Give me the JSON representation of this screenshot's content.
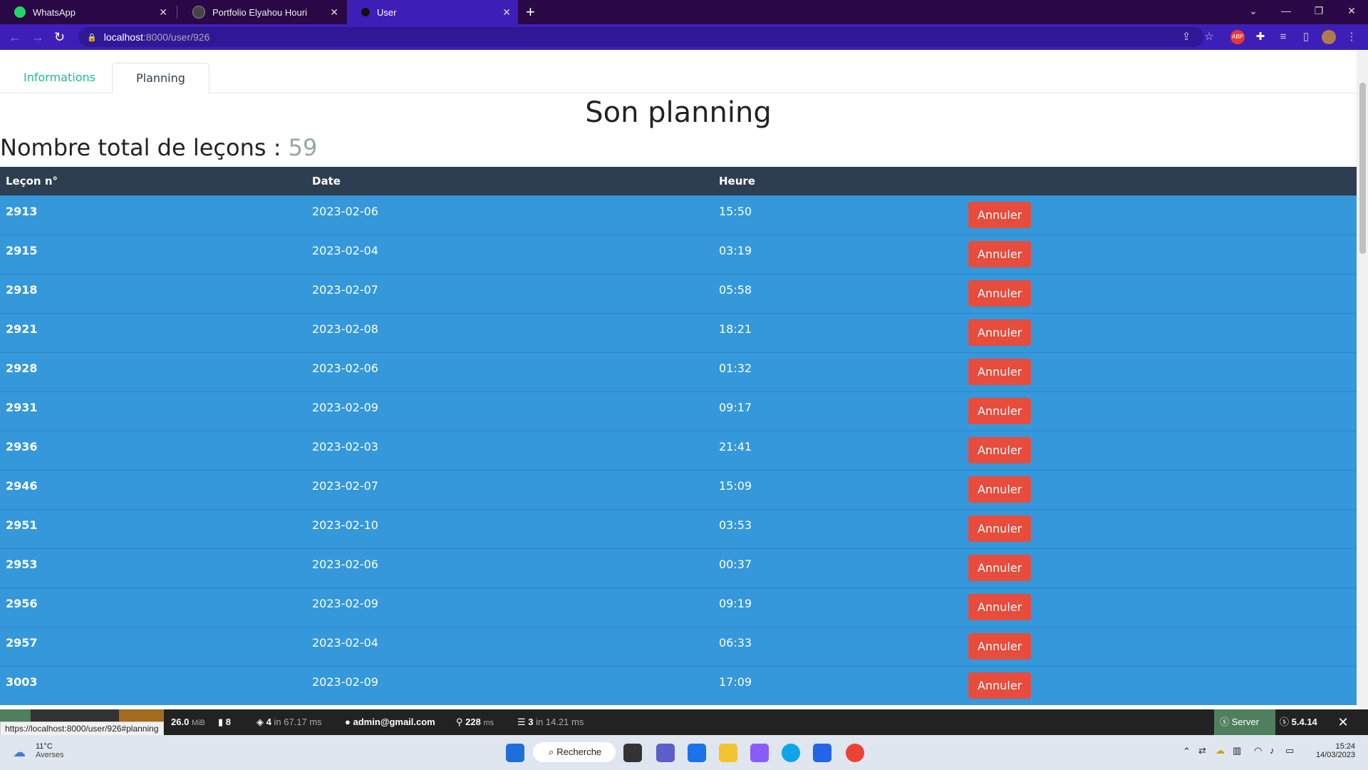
{
  "browser": {
    "tabs": [
      {
        "title": "WhatsApp",
        "icon": "whatsapp-icon"
      },
      {
        "title": "Portfolio Elyahou Houri",
        "icon": "globe-icon"
      },
      {
        "title": "User",
        "icon": "dot-icon",
        "active": true
      }
    ],
    "url_host": "localhost",
    "url_path": ":8000/user/926"
  },
  "page": {
    "tabs": [
      "Informations",
      "Planning"
    ],
    "active_tab": "Planning",
    "title": "Son planning",
    "total_label": "Nombre total de leçons :",
    "total_value": "59",
    "columns": [
      "Leçon n°",
      "Date",
      "Heure",
      ""
    ],
    "cancel_label": "Annuler",
    "rows": [
      {
        "id": "2913",
        "date": "2023-02-06",
        "time": "15:50"
      },
      {
        "id": "2915",
        "date": "2023-02-04",
        "time": "03:19"
      },
      {
        "id": "2918",
        "date": "2023-02-07",
        "time": "05:58"
      },
      {
        "id": "2921",
        "date": "2023-02-08",
        "time": "18:21"
      },
      {
        "id": "2928",
        "date": "2023-02-06",
        "time": "01:32"
      },
      {
        "id": "2931",
        "date": "2023-02-09",
        "time": "09:17"
      },
      {
        "id": "2936",
        "date": "2023-02-03",
        "time": "21:41"
      },
      {
        "id": "2946",
        "date": "2023-02-07",
        "time": "15:09"
      },
      {
        "id": "2951",
        "date": "2023-02-10",
        "time": "03:53"
      },
      {
        "id": "2953",
        "date": "2023-02-06",
        "time": "00:37"
      },
      {
        "id": "2956",
        "date": "2023-02-09",
        "time": "09:19"
      },
      {
        "id": "2957",
        "date": "2023-02-04",
        "time": "06:33"
      },
      {
        "id": "3003",
        "date": "2023-02-09",
        "time": "17:09"
      }
    ]
  },
  "debugbar": {
    "memory": "26.0",
    "memory_unit": "MiB",
    "logs": "8",
    "queries": "4",
    "queries_time": "in 67.17 ms",
    "user": "admin@gmail.com",
    "time": "228",
    "time_unit": "ms",
    "cache": "3",
    "cache_time": "in 14.21 ms",
    "server_label": "Server",
    "version": "5.4.14"
  },
  "status_url": "https://localhost:8000/user/926#planning",
  "taskbar": {
    "weather_temp": "11°C",
    "weather_desc": "Averses",
    "search_label": "Recherche",
    "time": "15:24",
    "date": "14/03/2023"
  },
  "colors": {
    "brand_primary": "#2c3e50",
    "row_blue": "#3498db",
    "danger": "#e74c3c",
    "tab_link": "#18bc9c"
  }
}
